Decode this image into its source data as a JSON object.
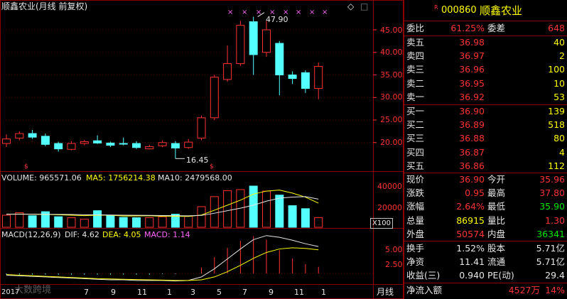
{
  "header": {
    "title": "顺鑫农业(月线 前复权)",
    "diamond": "◇",
    "square": "□"
  },
  "price_axis": [
    "45.00",
    "40.00",
    "35.00",
    "30.00",
    "25.00",
    "20.00"
  ],
  "annot": {
    "high": "47.90",
    "low": "16.45",
    "marker": "×",
    "s_mark": "$"
  },
  "volume": {
    "label": "VOLUME: 965571.06",
    "ma5": "MA5: 1756214.38",
    "ma10": "MA10: 2479568.00",
    "axis": [
      "40000",
      "20000"
    ],
    "unit": "X100"
  },
  "macd": {
    "label": "MACD(12,26,9)",
    "dif": "DIF: 4.62",
    "dea": "DEA: 4.05",
    "macd": "MACD: 1.14",
    "axis": [
      "5.00",
      "2.50"
    ]
  },
  "time_axis": {
    "labels": [
      "5",
      "7",
      "9",
      "11",
      "1",
      "3",
      "5",
      "7",
      "9",
      "11",
      "1"
    ],
    "first": "2017",
    "period": "月线"
  },
  "candles": [
    {
      "o": 19.8,
      "c": 20.8,
      "h": 21.8,
      "l": 19.0,
      "v": 12000
    },
    {
      "o": 21.0,
      "c": 22.0,
      "h": 22.5,
      "l": 20.5,
      "v": 14500
    },
    {
      "o": 22.0,
      "c": 21.2,
      "h": 22.8,
      "l": 20.8,
      "v": 11500
    },
    {
      "o": 21.4,
      "c": 19.6,
      "h": 22.0,
      "l": 19.2,
      "v": 15500
    },
    {
      "o": 19.8,
      "c": 18.6,
      "h": 20.2,
      "l": 18.0,
      "v": 10500
    },
    {
      "o": 18.5,
      "c": 19.8,
      "h": 20.3,
      "l": 18.3,
      "v": 9500
    },
    {
      "o": 19.8,
      "c": 20.2,
      "h": 20.6,
      "l": 19.4,
      "v": 8000
    },
    {
      "o": 20.4,
      "c": 19.9,
      "h": 21.6,
      "l": 19.7,
      "v": 16500
    },
    {
      "o": 19.9,
      "c": 19.4,
      "h": 20.2,
      "l": 19.0,
      "v": 12000
    },
    {
      "o": 19.8,
      "c": 19.7,
      "h": 21.1,
      "l": 19.4,
      "v": 9800
    },
    {
      "o": 19.8,
      "c": 18.9,
      "h": 20.3,
      "l": 18.6,
      "v": 9500
    },
    {
      "o": 18.6,
      "c": 19.1,
      "h": 19.5,
      "l": 18.5,
      "v": 9600
    },
    {
      "o": 19.3,
      "c": 20.0,
      "h": 20.5,
      "l": 19.0,
      "v": 10500
    },
    {
      "o": 19.8,
      "c": 18.8,
      "h": 20.3,
      "l": 16.45,
      "v": 13000
    },
    {
      "o": 18.9,
      "c": 20.1,
      "h": 20.8,
      "l": 18.6,
      "v": 11000
    },
    {
      "o": 21.0,
      "c": 25.5,
      "h": 26.0,
      "l": 20.5,
      "v": 20500
    },
    {
      "o": 25.5,
      "c": 34.5,
      "h": 35.0,
      "l": 25.0,
      "v": 30500
    },
    {
      "o": 34.0,
      "c": 37.5,
      "h": 41.5,
      "l": 33.5,
      "v": 36500
    },
    {
      "o": 37.5,
      "c": 46.0,
      "h": 47.0,
      "l": 37.0,
      "v": 37500
    },
    {
      "o": 46.8,
      "c": 39.5,
      "h": 47.9,
      "l": 35.0,
      "v": 41000
    },
    {
      "o": 40.0,
      "c": 45.0,
      "h": 47.0,
      "l": 39.0,
      "v": 36000
    },
    {
      "o": 42.0,
      "c": 35.0,
      "h": 42.5,
      "l": 30.5,
      "v": 32000
    },
    {
      "o": 35.0,
      "c": 34.2,
      "h": 35.8,
      "l": 33.0,
      "v": 21500
    },
    {
      "o": 35.5,
      "c": 32.0,
      "h": 36.0,
      "l": 31.0,
      "v": 18500
    },
    {
      "o": 32.0,
      "c": 36.9,
      "h": 37.8,
      "l": 29.6,
      "v": 9656
    }
  ],
  "vol_ma5": [
    13000,
    13200,
    13000,
    12800,
    12500,
    12000,
    11600,
    12000,
    12000,
    11200,
    11300,
    11500,
    11000,
    10900,
    10800,
    12200,
    17000,
    22000,
    27000,
    33000,
    36000,
    37000,
    34000,
    30000,
    24000
  ],
  "vol_ma10": [
    13000,
    13000,
    13000,
    12900,
    12800,
    12700,
    12500,
    12400,
    12200,
    12000,
    11900,
    11800,
    11700,
    11600,
    11400,
    11800,
    14000,
    16500,
    19000,
    22000,
    26000,
    29000,
    30000,
    30500,
    28000
  ],
  "macd_dif": [
    -0.3,
    -0.4,
    -0.5,
    -0.6,
    -0.7,
    -0.8,
    -0.9,
    -1.0,
    -1.1,
    -1.1,
    -1.2,
    -1.2,
    -1.2,
    -1.3,
    -1.2,
    -0.6,
    0.8,
    2.5,
    4.2,
    5.8,
    6.5,
    6.2,
    5.7,
    5.1,
    4.62
  ],
  "macd_dea": [
    -0.2,
    -0.3,
    -0.4,
    -0.5,
    -0.6,
    -0.7,
    -0.8,
    -0.9,
    -0.95,
    -1.0,
    -1.05,
    -1.1,
    -1.15,
    -1.2,
    -1.2,
    -1.1,
    -0.6,
    0.3,
    1.4,
    2.6,
    3.6,
    4.2,
    4.4,
    4.3,
    4.05
  ],
  "macd_hist": [
    -0.2,
    -0.2,
    -0.2,
    -0.2,
    -0.2,
    -0.2,
    -0.2,
    -0.2,
    -0.2,
    -0.2,
    -0.2,
    -0.2,
    -0.1,
    -0.1,
    0.0,
    1.0,
    2.8,
    4.4,
    5.6,
    6.4,
    5.8,
    4.0,
    2.6,
    1.6,
    1.14
  ],
  "quote": {
    "code": "000860",
    "name": "顺鑫农业",
    "r_mark": "R",
    "weibi_label": "委比",
    "weibi": "61.25%",
    "weicha_label": "委差",
    "weicha": "648",
    "asks": [
      {
        "label": "卖五",
        "price": "36.98",
        "vol": "40"
      },
      {
        "label": "卖四",
        "price": "36.97",
        "vol": "2"
      },
      {
        "label": "卖三",
        "price": "36.96",
        "vol": "100"
      },
      {
        "label": "卖二",
        "price": "36.95",
        "vol": "10"
      },
      {
        "label": "卖一",
        "price": "36.92",
        "vol": "53"
      }
    ],
    "bids": [
      {
        "label": "买一",
        "price": "36.90",
        "vol": "139"
      },
      {
        "label": "买二",
        "price": "36.89",
        "vol": "518"
      },
      {
        "label": "买三",
        "price": "36.88",
        "vol": "80"
      },
      {
        "label": "买四",
        "price": "36.87",
        "vol": "4"
      },
      {
        "label": "买五",
        "price": "36.86",
        "vol": "112"
      }
    ],
    "stats": [
      {
        "l1": "现价",
        "v1": "36.90",
        "c1": "red",
        "l2": "今开",
        "v2": "35.96",
        "c2": "red"
      },
      {
        "l1": "涨跌",
        "v1": "0.95",
        "c1": "red",
        "l2": "最高",
        "v2": "37.80",
        "c2": "red"
      },
      {
        "l1": "涨幅",
        "v1": "2.64%",
        "c1": "red",
        "l2": "最低",
        "v2": "35.90",
        "c2": "green"
      },
      {
        "l1": "总量",
        "v1": "86915",
        "c1": "yellow",
        "l2": "量比",
        "v2": "1.30",
        "c2": "red"
      },
      {
        "l1": "外盘",
        "v1": "50574",
        "c1": "red",
        "l2": "内盘",
        "v2": "36341",
        "c2": "green"
      }
    ],
    "stats2": [
      {
        "l1": "换手",
        "v1": "1.52%",
        "l2": "股本",
        "v2": "5.71亿"
      },
      {
        "l1": "净资",
        "v1": "11.41",
        "l2": "流通",
        "v2": "5.71亿"
      },
      {
        "l1": "收益(三)",
        "v1": "0.940",
        "l2": "PE(动)",
        "v2": "29.4"
      }
    ],
    "netflow_label": "净流入额",
    "netflow": "4527万",
    "netflow_pct": "14%"
  },
  "watermark": "大数跨境"
}
